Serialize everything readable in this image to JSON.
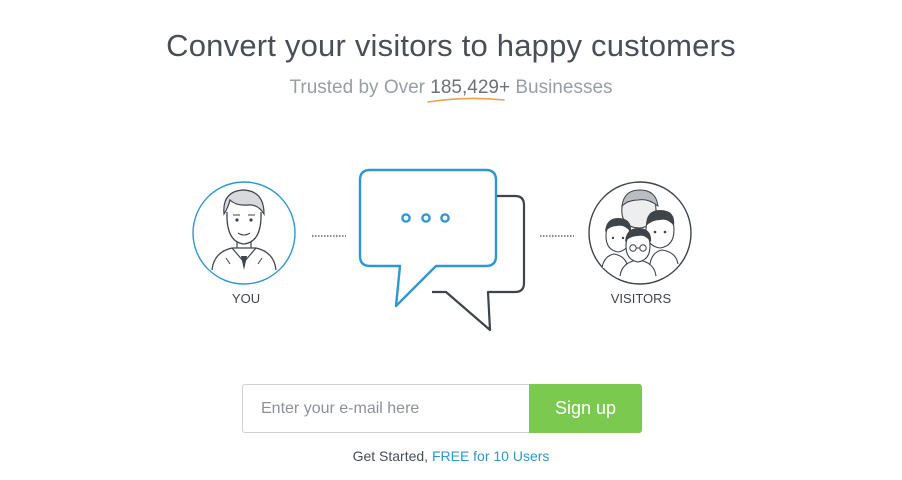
{
  "hero": {
    "title": "Convert your visitors to happy customers",
    "subtitle_prefix": "Trusted by Over",
    "subtitle_count": "185,429+",
    "subtitle_suffix": "Businesses"
  },
  "illustration": {
    "you_label": "YOU",
    "visitors_label": "VISITORS",
    "you_icon": "agent-avatar-icon",
    "chat_icon": "chat-bubbles-icon",
    "visitors_icon": "visitors-group-icon"
  },
  "signup": {
    "email_placeholder": "Enter your e-mail here",
    "button_label": "Sign up"
  },
  "footnote": {
    "text": "Get Started,",
    "link": "FREE for 10 Users"
  },
  "colors": {
    "accent_blue": "#2f96d2",
    "button_green": "#7cc950",
    "underline_orange": "#f0a04b",
    "outline_dark": "#3f4449"
  }
}
